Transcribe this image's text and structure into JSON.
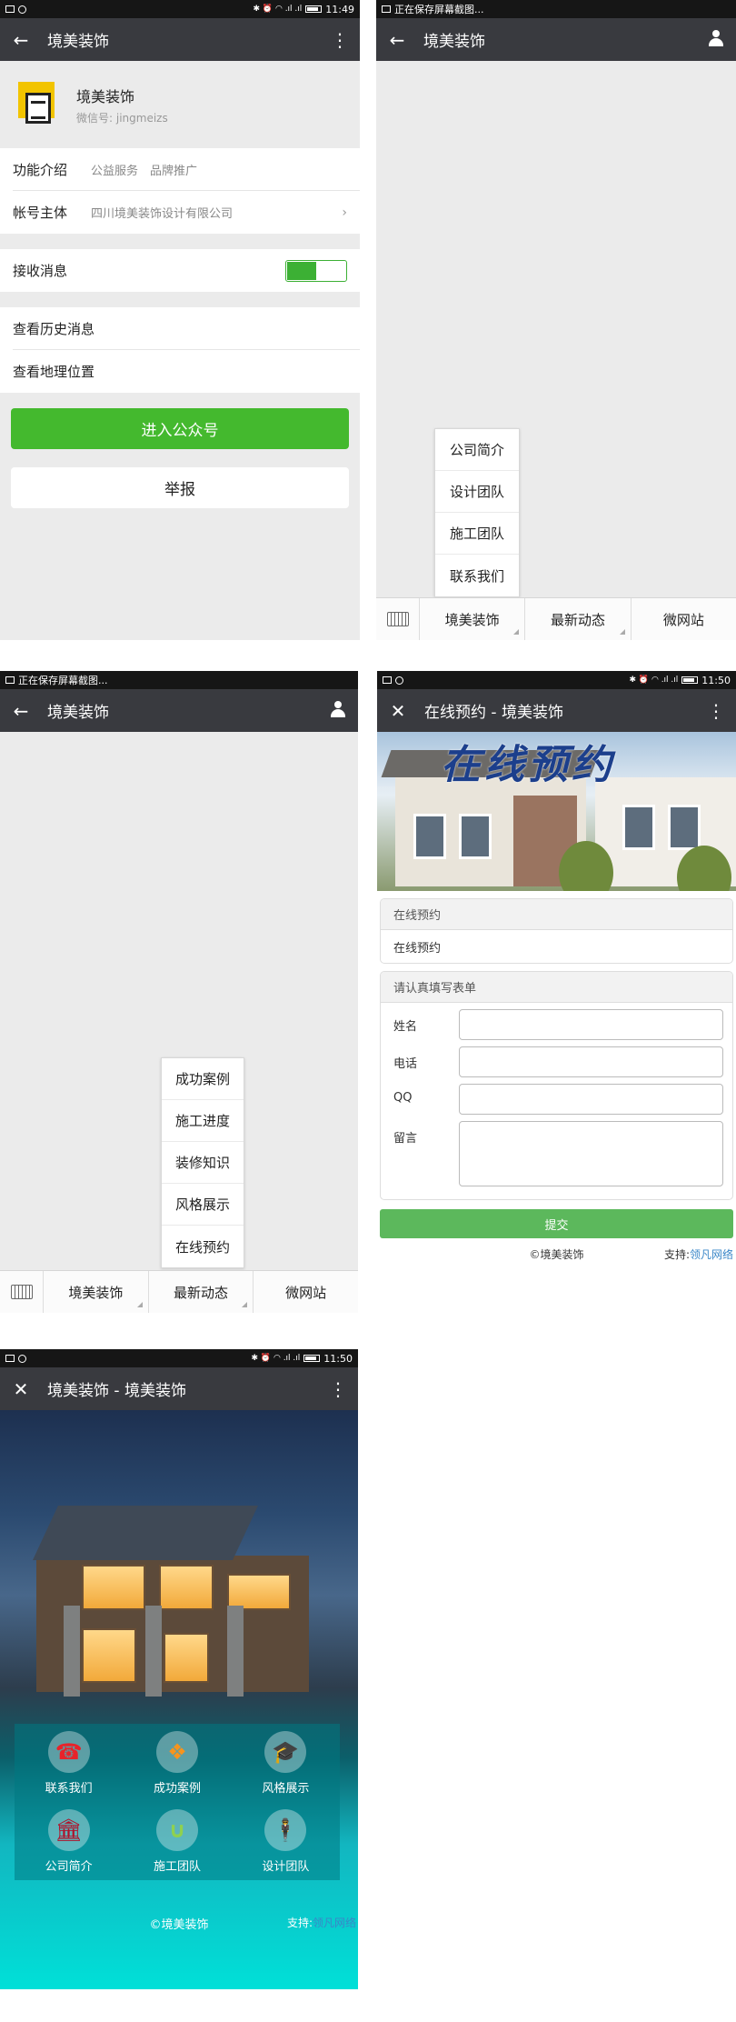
{
  "screen1": {
    "status": {
      "time": "11:49"
    },
    "nav": {
      "title": "境美装饰",
      "back_icon": "←",
      "more_icon": "⋮"
    },
    "profile": {
      "name": "境美装饰",
      "wechat_id": "微信号: jingmeizs"
    },
    "rows": [
      {
        "label": "功能介绍",
        "value": "公益服务　品牌推广"
      },
      {
        "label": "帐号主体",
        "value": "四川境美装饰设计有限公司",
        "chevron": "›"
      }
    ],
    "receive": {
      "label": "接收消息"
    },
    "links": [
      {
        "label": "查看历史消息"
      },
      {
        "label": "查看地理位置"
      }
    ],
    "enter_button": "进入公众号",
    "report_button": "举报"
  },
  "screen2": {
    "status": {
      "text": "正在保存屏幕截图..."
    },
    "nav": {
      "title": "境美装饰",
      "back_icon": "←"
    },
    "popup": [
      "公司简介",
      "设计团队",
      "施工团队",
      "联系我们"
    ],
    "menu": [
      "境美装饰",
      "最新动态",
      "微网站"
    ]
  },
  "screen3": {
    "status": {
      "text": "正在保存屏幕截图..."
    },
    "nav": {
      "title": "境美装饰",
      "back_icon": "←"
    },
    "popup": [
      "成功案例",
      "施工进度",
      "装修知识",
      "风格展示",
      "在线预约"
    ],
    "menu": [
      "境美装饰",
      "最新动态",
      "微网站"
    ]
  },
  "screen4": {
    "status": {
      "time": "11:50"
    },
    "nav": {
      "title": "在线预约 - 境美装饰",
      "close_icon": "✕",
      "more_icon": "⋮"
    },
    "banner_title": "在线预约",
    "section1": {
      "header": "在线预约",
      "body": "在线预约"
    },
    "section2": {
      "header": "请认真填写表单",
      "fields": [
        "姓名",
        "电话",
        "QQ",
        "留言"
      ]
    },
    "submit": "提交",
    "footer": {
      "copyright": "©境美装饰",
      "support_label": "支持:",
      "support_link": "领凡网络"
    }
  },
  "screen5": {
    "status": {
      "time": "11:50"
    },
    "nav": {
      "title": "境美装饰 - 境美装饰",
      "close_icon": "✕",
      "more_icon": "⋮"
    },
    "tiles": [
      {
        "label": "联系我们",
        "icon": "phone-icon",
        "glyph": "☎",
        "color": "#e8232a"
      },
      {
        "label": "成功案例",
        "icon": "cubes-icon",
        "glyph": "❖",
        "color": "#f7941d"
      },
      {
        "label": "风格展示",
        "icon": "graduation-cap-icon",
        "glyph": "🎓",
        "color": "#2ecc40"
      },
      {
        "label": "公司简介",
        "icon": "bank-icon",
        "glyph": "🏛",
        "color": "#b0122a"
      },
      {
        "label": "施工团队",
        "icon": "magnet-icon",
        "glyph": "∪",
        "color": "#8fd14f"
      },
      {
        "label": "设计团队",
        "icon": "person-icon",
        "glyph": "🕴",
        "color": "#e23fd6"
      }
    ],
    "footer": {
      "copyright": "©境美装饰",
      "support_label": "支持:",
      "support_link": "领凡网络"
    }
  }
}
